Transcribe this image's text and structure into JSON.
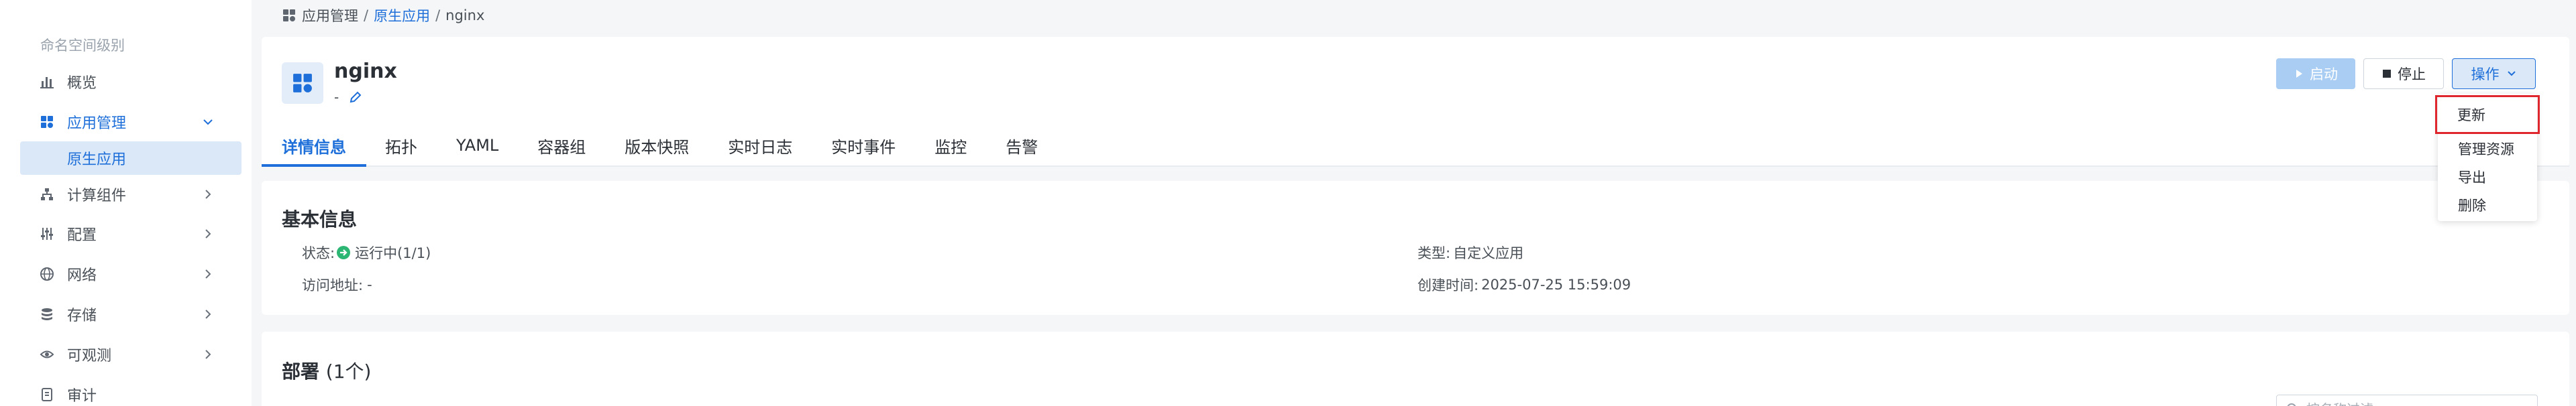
{
  "sidebar": {
    "group_title": "命名空间级别",
    "items": [
      {
        "label": "概览",
        "icon": "bar-chart-icon"
      },
      {
        "label": "应用管理",
        "icon": "grid-icon"
      },
      {
        "label": "计算组件",
        "icon": "nodes-icon"
      },
      {
        "label": "配置",
        "icon": "sliders-icon"
      },
      {
        "label": "网络",
        "icon": "globe-icon"
      },
      {
        "label": "存储",
        "icon": "database-icon"
      },
      {
        "label": "可观测",
        "icon": "eye-icon"
      },
      {
        "label": "审计",
        "icon": "audit-icon"
      }
    ],
    "sub_item": "原生应用"
  },
  "breadcrumb": {
    "root": "应用管理",
    "sep1": "/",
    "middle": "原生应用",
    "sep2": "/",
    "current": "nginx"
  },
  "app": {
    "name": "nginx",
    "description": "-"
  },
  "actions": {
    "start": "启动",
    "stop": "停止",
    "operations": "操作"
  },
  "dropdown": {
    "items": [
      "更新",
      "管理资源",
      "导出",
      "删除"
    ]
  },
  "tabs": [
    "详情信息",
    "拓扑",
    "YAML",
    "容器组",
    "版本快照",
    "实时日志",
    "实时事件",
    "监控",
    "告警"
  ],
  "basic_info": {
    "title": "基本信息",
    "status_label": "状态:",
    "status_value": "运行中(1/1)",
    "access_label": "访问地址:",
    "access_value": "-",
    "type_label": "类型:",
    "type_value": "自定义应用",
    "created_label": "创建时间:",
    "created_value": "2025-07-25 15:59:09"
  },
  "deployment": {
    "title": "部署",
    "count": "(1个)",
    "search_placeholder": "按名称过滤"
  },
  "colors": {
    "accent": "#1e6fd9",
    "success": "#2bb673",
    "highlight_border": "#e0262d"
  }
}
